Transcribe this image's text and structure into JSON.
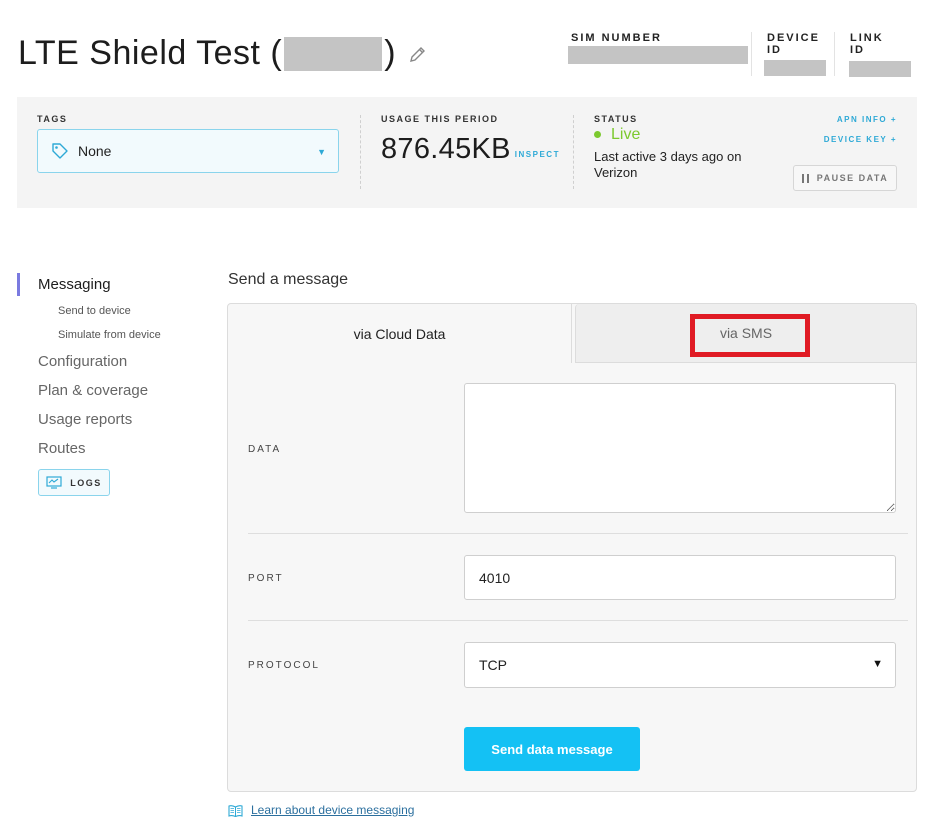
{
  "header": {
    "title_prefix": "LTE Shield Test (",
    "title_suffix": ")",
    "sim_label": "SIM NUMBER",
    "device_id_label_1": "DEVICE",
    "device_id_label_2": "ID",
    "link_id_label_1": "LINK",
    "link_id_label_2": "ID"
  },
  "topbar": {
    "tags_label": "TAGS",
    "tags_value": "None",
    "usage_label": "USAGE THIS PERIOD",
    "usage_value": "876.45KB",
    "inspect_label": "INSPECT",
    "status_label": "STATUS",
    "status_value": "Live",
    "last_active_1": "Last active 3 days ago on",
    "last_active_2": "Verizon",
    "apn_info": "APN INFO +",
    "device_key": "DEVICE KEY +",
    "pause_label": "PAUSE DATA"
  },
  "sidebar": {
    "messaging": "Messaging",
    "send_to_device": "Send to device",
    "simulate_from_device": "Simulate from device",
    "configuration": "Configuration",
    "plan_coverage": "Plan & coverage",
    "usage_reports": "Usage reports",
    "routes": "Routes",
    "logs": "LOGS"
  },
  "main": {
    "heading": "Send a message",
    "tab_cloud": "via Cloud Data",
    "tab_sms": "via SMS",
    "data_label": "DATA",
    "data_value": "",
    "port_label": "PORT",
    "port_value": "4010",
    "protocol_label": "PROTOCOL",
    "protocol_value": "TCP",
    "send_button": "Send data message",
    "learn_link": "Learn about device messaging"
  },
  "colors": {
    "accent": "#14c1f4",
    "live": "#7cc92e",
    "nav_indicator": "#7a7ae0",
    "highlight": "#e01b24"
  }
}
